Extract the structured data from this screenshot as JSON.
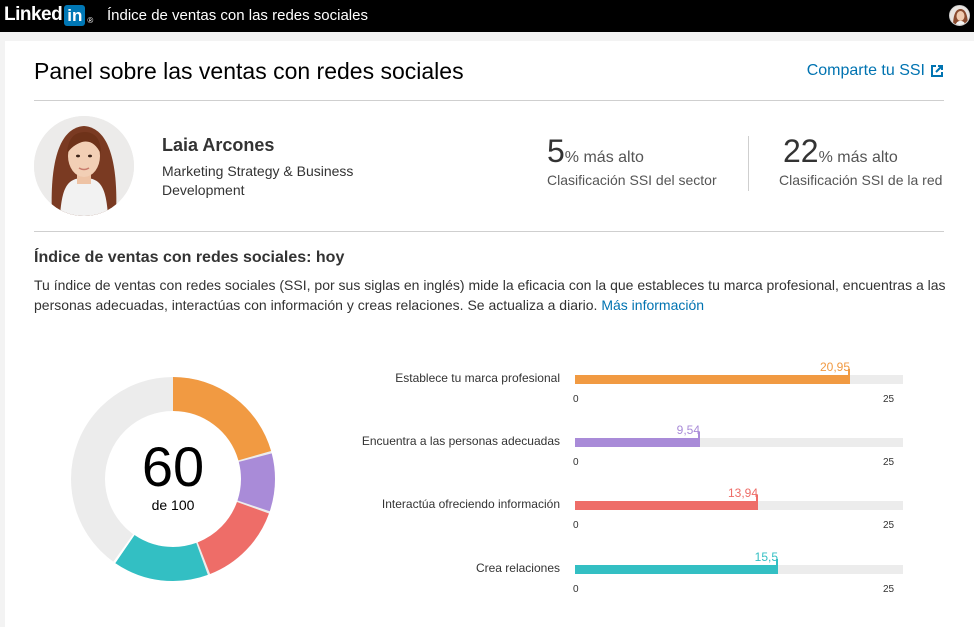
{
  "topbar": {
    "logo_text": "Linked",
    "logo_in": "in",
    "logo_reg": "®",
    "title": "Índice de ventas con las redes sociales"
  },
  "header": {
    "title": "Panel sobre las ventas con redes sociales",
    "share_label": "Comparte tu SSI",
    "share_icon": "external-link-icon"
  },
  "profile": {
    "name": "Laia Arcones",
    "role": "Marketing Strategy & Business Development"
  },
  "rankings": [
    {
      "value": "5",
      "suffix": "% más alto",
      "label": "Clasificación SSI del sector"
    },
    {
      "value": "22",
      "suffix": "% más alto",
      "label": "Clasificación SSI de la red"
    }
  ],
  "ssi": {
    "title": "Índice de ventas con redes sociales: hoy",
    "description": "Tu índice de ventas con redes sociales (SSI, por sus siglas en inglés) mide la eficacia con la que estableces tu marca profesional, encuentras a las personas adecuadas, interactúas con información y creas relaciones. Se actualiza a diario.",
    "more_link": "Más información",
    "score": "60",
    "score_max_label": "de 100"
  },
  "chart_data": {
    "type": "bar",
    "orientation": "horizontal",
    "total": 60,
    "max_total": 100,
    "xlim": [
      0,
      25
    ],
    "axis_min_label": "0",
    "axis_max_label": "25",
    "bars": [
      {
        "label": "Establece tu marca profesional",
        "value": 20.95,
        "value_label": "20,95",
        "color": "#f19a42"
      },
      {
        "label": "Encuentra a las personas adecuadas",
        "value": 9.54,
        "value_label": "9,54",
        "color": "#a98bd8"
      },
      {
        "label": "Interactúa ofreciendo información",
        "value": 13.94,
        "value_label": "13,94",
        "color": "#ee6d68"
      },
      {
        "label": "Crea relaciones",
        "value": 15.5,
        "value_label": "15,5",
        "color": "#33bfc3"
      }
    ],
    "remainder_color": "#ececec"
  }
}
